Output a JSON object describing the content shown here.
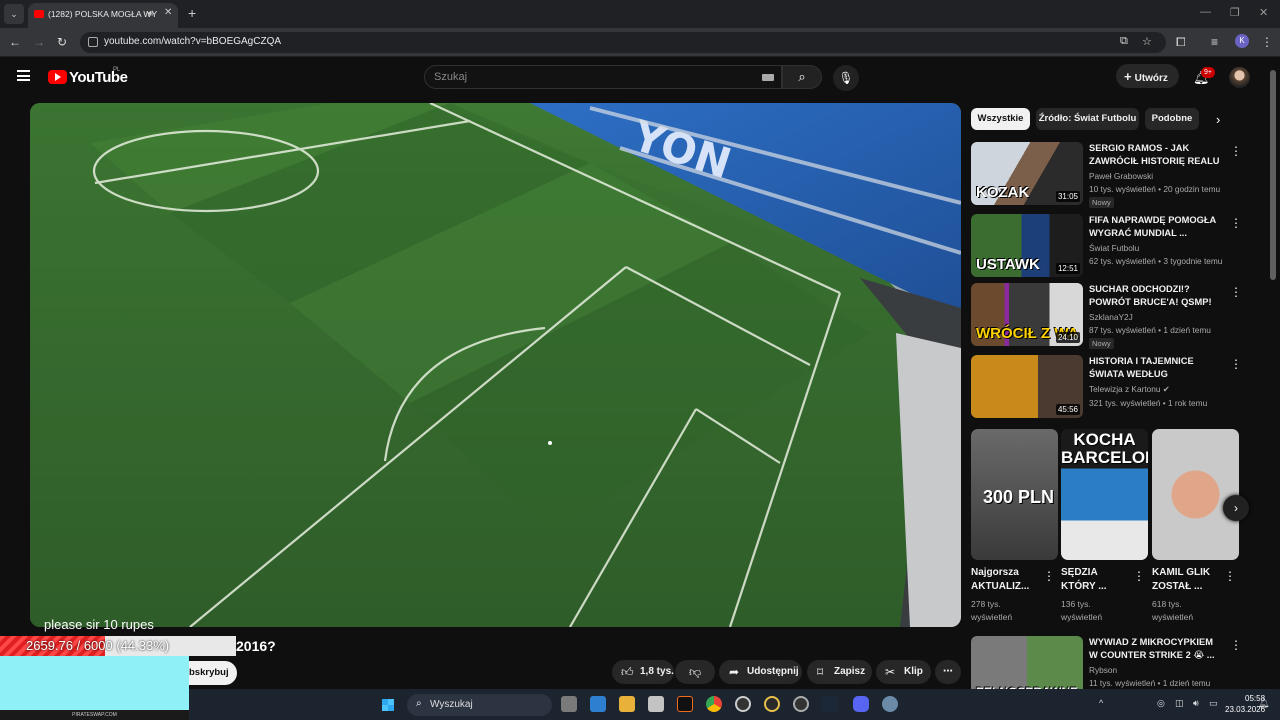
{
  "browser": {
    "tab_title": "(1282) POLSKA MOGŁA WY",
    "url": "youtube.com/watch?v=bBOEGAgCZQA",
    "profile_initial": "K"
  },
  "youtube": {
    "logo_text": "YouTube",
    "region": "PL",
    "search_placeholder": "Szukaj",
    "create_label": "Utwórz",
    "notification_count": "9+"
  },
  "video": {
    "overlay_message": "please sir 10 rupes",
    "progress": {
      "text": "2659.76 / 6000 (44.33%)",
      "fraction": 0.4433
    },
    "title_fragment": "2016?",
    "subscribe_label": "bskrybuj",
    "stream_watermark": "PIRATESWAP.COM",
    "actions": {
      "likes": "1,8 tys.",
      "share": "Udostępnij",
      "save": "Zapisz",
      "clip": "Klip"
    }
  },
  "sidebar": {
    "chips": [
      "Wszystkie",
      "Źródło: Świat Futbolu",
      "Podobne"
    ],
    "recommendations": [
      {
        "title": "SERGIO RAMOS - JAK ZAWRÓCIŁ HISTORIĘ REALU ...",
        "channel": "Paweł Grabowski",
        "meta": "10 tys. wyświetleń • 20 godzin temu",
        "badge": "Nowy",
        "duration": "31:05",
        "thumb_text": "KOZAK",
        "verified": false
      },
      {
        "title": "FIFA NAPRAWDĘ POMOGŁA WYGRAĆ MUNDIAL ...",
        "channel": "Świat Futbolu",
        "meta": "62 tys. wyświetleń • 3 tygodnie temu",
        "badge": "",
        "duration": "12:51",
        "thumb_text": "USTAWK",
        "verified": false
      },
      {
        "title": "SUCHAR ODCHODZI!? POWRÓT BRUCE'A! QSMP! PATIRO! ...",
        "channel": "SzklanaY2J",
        "meta": "87 tys. wyświetleń • 1 dzień temu",
        "badge": "Nowy",
        "duration": "24:10",
        "thumb_text": "WRÓCIŁ Z WA",
        "verified": false
      },
      {
        "title": "HISTORIA I TAJEMNICE ŚWIATA WEDŁUG KIEPSKICH",
        "channel": "Telewizja z Kartonu",
        "meta": "321 tys. wyświetleń • 1 rok temu",
        "badge": "",
        "duration": "45:56",
        "thumb_text": "",
        "verified": true
      }
    ],
    "shorts": [
      {
        "title": "Najgorsza AKTUALIZ...",
        "views": "278 tys. wyświetleń",
        "thumb_text": "300 PLN"
      },
      {
        "title": "SĘDZIA KTÓRY ...",
        "views": "136 tys. wyświetleń",
        "thumb_text": "KOCHA BARCELONE"
      },
      {
        "title": "KAMIL GLIK ZOSTAŁ ...",
        "views": "618 tys. wyświetleń",
        "thumb_text": ""
      }
    ],
    "bottom_rec": {
      "title": "WYWIAD Z MIKROCYPKIEM W COUNTER STRIKE 2 😭 ...",
      "channel": "Rybson",
      "meta": "11 tys. wyświetleń • 1 dzień temu",
      "thumb_text": "PEŁNOSPRAWNE"
    }
  },
  "taskbar": {
    "search_label": "Wyszukaj",
    "time": "05:58",
    "date": "23.03.2026"
  }
}
